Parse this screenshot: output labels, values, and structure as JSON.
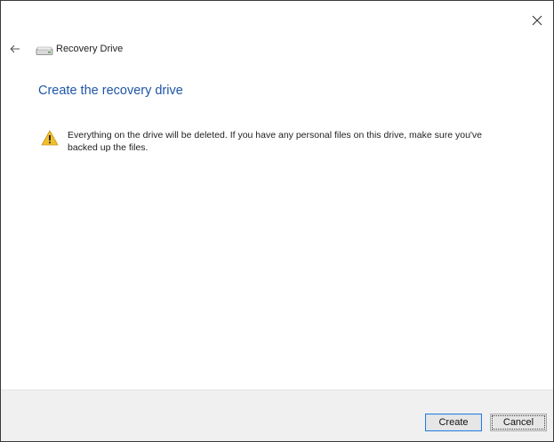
{
  "window": {
    "close_glyph": "✕"
  },
  "nav": {
    "back_glyph": "←",
    "title": "Recovery Drive"
  },
  "main": {
    "heading": "Create the recovery drive",
    "warning": "Everything on the drive will be deleted. If you have any personal files on this drive, make sure you've backed up the files."
  },
  "footer": {
    "create_label": "Create",
    "cancel_label": "Cancel"
  },
  "icons": {
    "close": "close-icon",
    "back": "back-arrow-icon",
    "drive": "drive-icon",
    "warning": "warning-icon"
  },
  "colors": {
    "heading": "#1f56a8",
    "warning_fill": "#f2c02b",
    "footer_bg": "#f0f0f0",
    "focus_border": "#2f7ad3"
  }
}
